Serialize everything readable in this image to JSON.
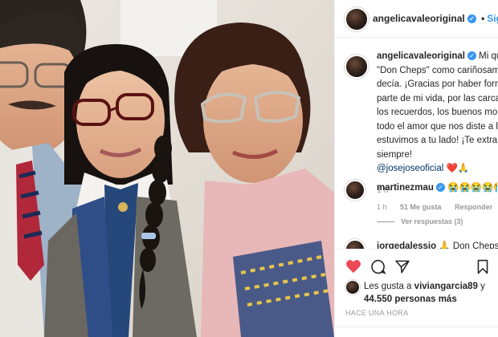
{
  "post": {
    "username": "angelicavaleoriginal",
    "follow_label": "Siguie",
    "caption_lines": [
      "Mi quer",
      "\"Don Cheps\" como cariñosame",
      "decía. ¡Gracias por haber forma",
      "parte de mi vida, por las carcaja",
      "los recuerdos, los buenos mom",
      "todo el amor que nos diste a lo",
      "estuvimos a tu lado! ¡Te extrañ",
      "siempre!"
    ],
    "caption_mention": "@josejoseoficial",
    "caption_emojis": "❤️🙏",
    "time_ago": "1 h"
  },
  "comments": [
    {
      "username": "martinezmau",
      "text": "😭😭😭😭😭",
      "time": "1 h",
      "likes": "51 Me gusta",
      "reply_label": "Responder",
      "view_replies": "Ver respuestas (3)"
    },
    {
      "username": "jorgedalessio",
      "text": "🙏 Don Cheps"
    }
  ],
  "likes": {
    "prefix": "Les gusta a",
    "user": "viviangarcia89",
    "conjunction": "y",
    "count": "44.550 personas más"
  },
  "timestamp": "HACE UNA HORA",
  "colors": {
    "heart": "#ed4956",
    "verified": "#3897f0",
    "mention": "#003569"
  },
  "icons": [
    "more-options-icon",
    "heart-icon",
    "comment-icon",
    "share-icon",
    "bookmark-icon"
  ]
}
